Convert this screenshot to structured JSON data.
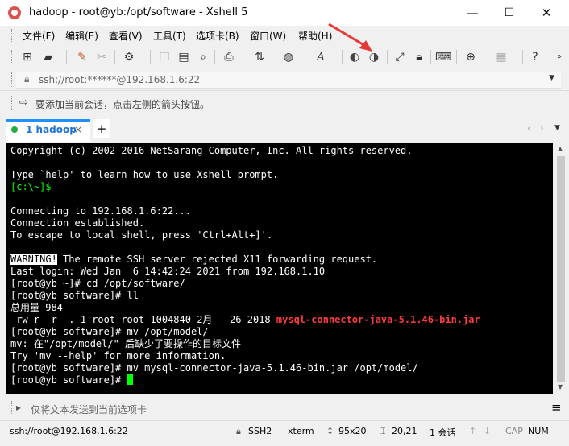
{
  "window": {
    "title": "hadoop - root@yb:/opt/software - Xshell 5",
    "minimize": "—",
    "maximize": "☐",
    "close": "✕"
  },
  "menu": [
    "文件(F)",
    "编辑(E)",
    "查看(V)",
    "工具(T)",
    "选项卡(B)",
    "窗口(W)",
    "帮助(H)"
  ],
  "address": {
    "value": "ssh://root:******@192.168.1.6:22"
  },
  "infobar": {
    "text": "要添加当前会话，点击左侧的箭头按钮。"
  },
  "tabs": [
    {
      "label": "1 hadoop"
    }
  ],
  "tab_add": "+",
  "terminal": {
    "lines": [
      {
        "text": "Copyright (c) 2002-2016 NetSarang Computer, Inc. All rights reserved."
      },
      {
        "text": ""
      },
      {
        "text": "Type `help' to learn how to use Xshell prompt."
      },
      {
        "prompt": "[c:\\~]$"
      },
      {
        "text": ""
      },
      {
        "text": "Connecting to 192.168.1.6:22..."
      },
      {
        "text": "Connection established."
      },
      {
        "text": "To escape to local shell, press 'Ctrl+Alt+]'."
      },
      {
        "text": ""
      },
      {
        "warning": "WARNING!",
        "rest": " The remote SSH server rejected X11 forwarding request."
      },
      {
        "text": "Last login: Wed Jan  6 14:42:24 2021 from 192.168.1.10"
      },
      {
        "text": "[root@yb ~]# cd /opt/software/"
      },
      {
        "text": "[root@yb software]# ll"
      },
      {
        "text": "总用量 984"
      },
      {
        "text": "-rw-r--r--. 1 root root 1004840 2月   26 2018 ",
        "red": "mysql-connector-java-5.1.46-bin.jar"
      },
      {
        "text": "[root@yb software]# mv /opt/model/"
      },
      {
        "text": "mv: 在\"/opt/model/\" 后缺少了要操作的目标文件"
      },
      {
        "text": "Try 'mv --help' for more information."
      },
      {
        "text": "[root@yb software]# mv mysql-connector-java-5.1.46-bin.jar /opt/model/"
      },
      {
        "text": "[root@yb software]# ",
        "cursor": true
      }
    ]
  },
  "sendbar": {
    "placeholder": "仅将文本发送到当前选项卡"
  },
  "status": {
    "connection": "ssh://root@192.168.1.6:22",
    "protocol": "SSH2",
    "terminal": "xterm",
    "size": "95x20",
    "position": "20,21",
    "sessions": "1 会话",
    "caps": "CAP",
    "num": "NUM"
  },
  "colors": {
    "accent": "#1e90ff",
    "terminal_bg": "#000000",
    "prompt_green": "#00ff00",
    "red": "#ff3b3b"
  }
}
